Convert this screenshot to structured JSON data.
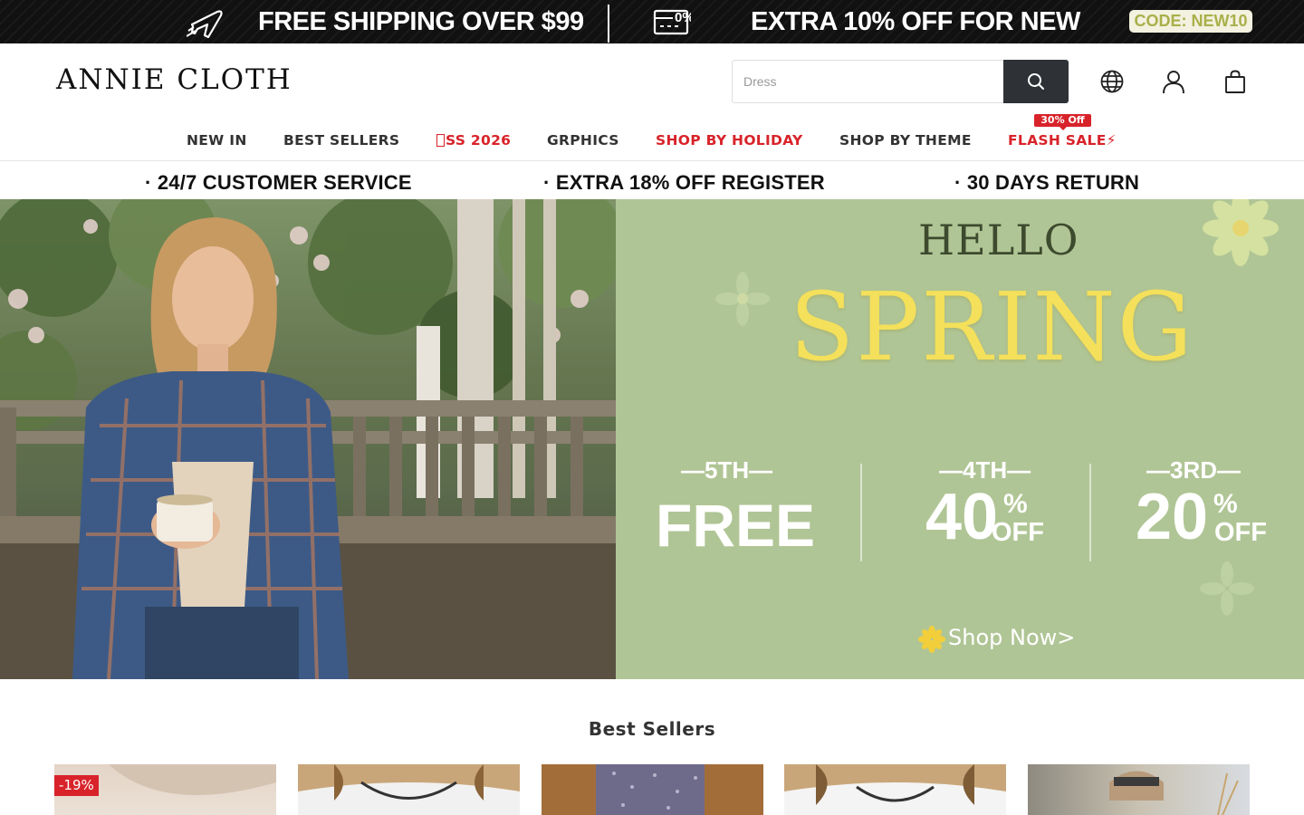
{
  "promo": {
    "shipping_text": "FREE SHIPPING OVER $99",
    "extra_text": "EXTRA 10% OFF FOR NEW",
    "code_text": "CODE: NEW10"
  },
  "header": {
    "logo": "ANNIE CLOTH",
    "search_placeholder": "Dress"
  },
  "nav": {
    "items": [
      "NEW IN",
      "BEST SELLERS",
      "SS 2026",
      "GRPHICS",
      "SHOP BY HOLIDAY",
      "SHOP BY THEME",
      "FLASH SALE⚡"
    ],
    "flash_badge": "30% Off",
    "highlight_color": "#d8232a"
  },
  "services": [
    "·  24/7 CUSTOMER SERVICE",
    "·  EXTRA 18% OFF REGISTER",
    "·  30 DAYS RETURN"
  ],
  "hero": {
    "hello": "HELLO",
    "headline": "SPRING",
    "offers": [
      {
        "tier": "—5TH—",
        "value": "FREE"
      },
      {
        "tier": "—4TH—",
        "value": "40",
        "unit": "%",
        "suffix": "OFF"
      },
      {
        "tier": "—3RD—",
        "value": "20",
        "unit": "%",
        "suffix": "OFF"
      }
    ],
    "cta": "Shop Now>"
  },
  "best_sellers": {
    "title": "Best Sellers",
    "first_discount": "-19%"
  }
}
